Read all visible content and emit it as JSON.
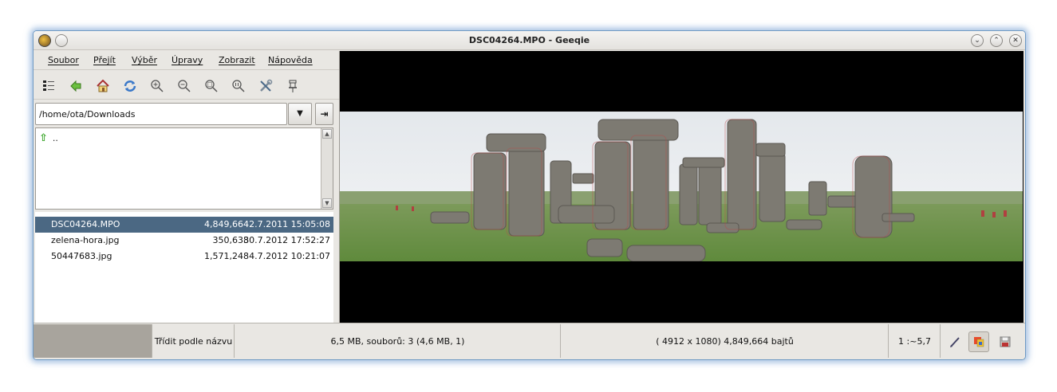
{
  "window": {
    "title": "DSC04264.MPO - Geeqie"
  },
  "menu": [
    "Soubor",
    "Přejít",
    "Výběr",
    "Úpravy",
    "Zobrazit",
    "Nápověda"
  ],
  "toolbar_icons": [
    "thumbnails-icon",
    "back-icon",
    "home-icon",
    "refresh-icon",
    "zoom-in-icon",
    "zoom-out-icon",
    "zoom-fit-icon",
    "zoom-1to1-icon",
    "preferences-icon",
    "float-icon"
  ],
  "path": {
    "value": "/home/ota/Downloads"
  },
  "dir_list": [
    {
      "name": ".."
    }
  ],
  "files": [
    {
      "name": "DSC04264.MPO",
      "size": "4,849,664",
      "date": "2.7.2011 15:05:08",
      "selected": true
    },
    {
      "name": "zelena-hora.jpg",
      "size": "350,638",
      "date": "30.7.2012 17:52:27",
      "selected": false
    },
    {
      "name": "50447683.jpg",
      "size": "1,571,248",
      "date": "4.7.2012 10:21:07",
      "selected": false
    }
  ],
  "status": {
    "sort": "Třídit podle názvu",
    "summary": "6,5 MB, souborů: 3 (4,6 MB, 1)",
    "image_info": "( 4912 x 1080) 4,849,664 bajtů",
    "zoom": "1 :~5,7"
  },
  "colors": {
    "selection": "#4b6883",
    "accent_border": "#6f9ac4"
  }
}
